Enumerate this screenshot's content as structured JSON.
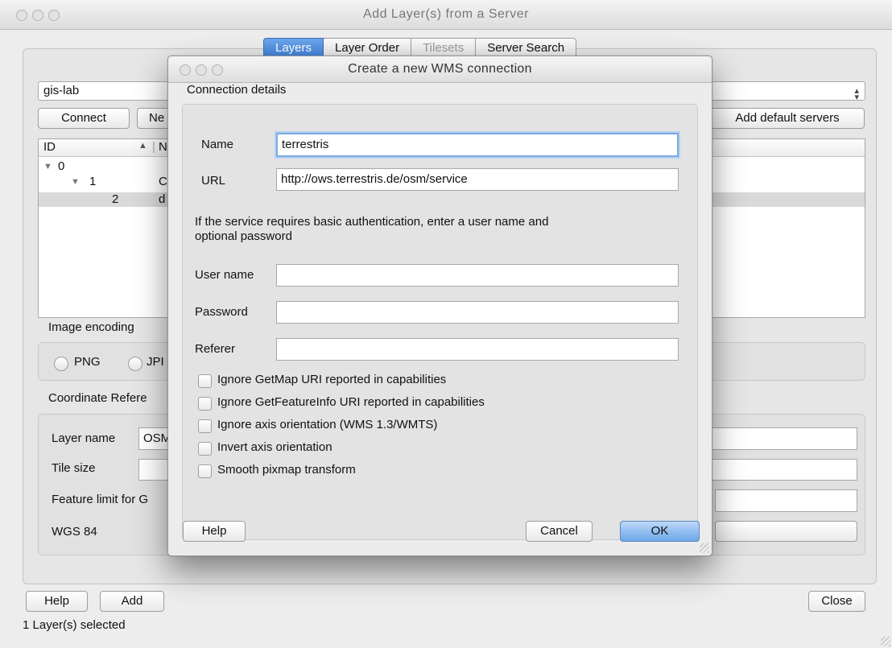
{
  "window": {
    "title": "Add Layer(s) from a Server",
    "tabs": [
      {
        "label": "Layers",
        "state": "active"
      },
      {
        "label": "Layer Order",
        "state": "normal"
      },
      {
        "label": "Tilesets",
        "state": "disabled"
      },
      {
        "label": "Server Search",
        "state": "normal"
      }
    ],
    "connection_combo": "gis-lab",
    "buttons": {
      "connect": "Connect",
      "new_partial": "Ne",
      "add_default_servers": "Add default servers",
      "help": "Help",
      "add": "Add",
      "close": "Close"
    },
    "tree": {
      "col_id": "ID",
      "col_name_partial": "N",
      "rows": [
        {
          "id": "0",
          "name": ""
        },
        {
          "id": "1",
          "name": "C"
        },
        {
          "id": "2",
          "name": "d"
        }
      ]
    },
    "image_encoding": {
      "label": "Image encoding",
      "options": [
        "PNG",
        "JPI"
      ]
    },
    "crs_label_partial": "Coordinate Refere",
    "options_group": {
      "layer_name_label": "Layer name",
      "layer_name_value": "OSM",
      "tile_size_label": "Tile size",
      "feature_limit_label": "Feature limit for G",
      "crs_value": "WGS 84"
    },
    "status": "1 Layer(s) selected"
  },
  "dialog": {
    "title": "Create a new WMS connection",
    "group_title": "Connection details",
    "name_label": "Name",
    "name_value": "terrestris",
    "url_label": "URL",
    "url_value": "http://ows.terrestris.de/osm/service",
    "auth_note_line1": "If the service requires basic authentication, enter a user name and",
    "auth_note_line2": "optional password",
    "username_label": "User name",
    "username_value": "",
    "password_label": "Password",
    "password_value": "",
    "referer_label": "Referer",
    "referer_value": "",
    "checkboxes": [
      {
        "label": "Ignore GetMap URI reported in capabilities",
        "checked": false
      },
      {
        "label": "Ignore GetFeatureInfo URI reported in capabilities",
        "checked": false
      },
      {
        "label": "Ignore axis orientation (WMS 1.3/WMTS)",
        "checked": false
      },
      {
        "label": "Invert axis orientation",
        "checked": false
      },
      {
        "label": "Smooth pixmap transform",
        "checked": false
      }
    ],
    "buttons": {
      "help": "Help",
      "cancel": "Cancel",
      "ok": "OK"
    }
  },
  "colors": {
    "active_tab": "#3c7fd9",
    "default_button": "#6fa7ea",
    "window_bg": "#ededed"
  }
}
